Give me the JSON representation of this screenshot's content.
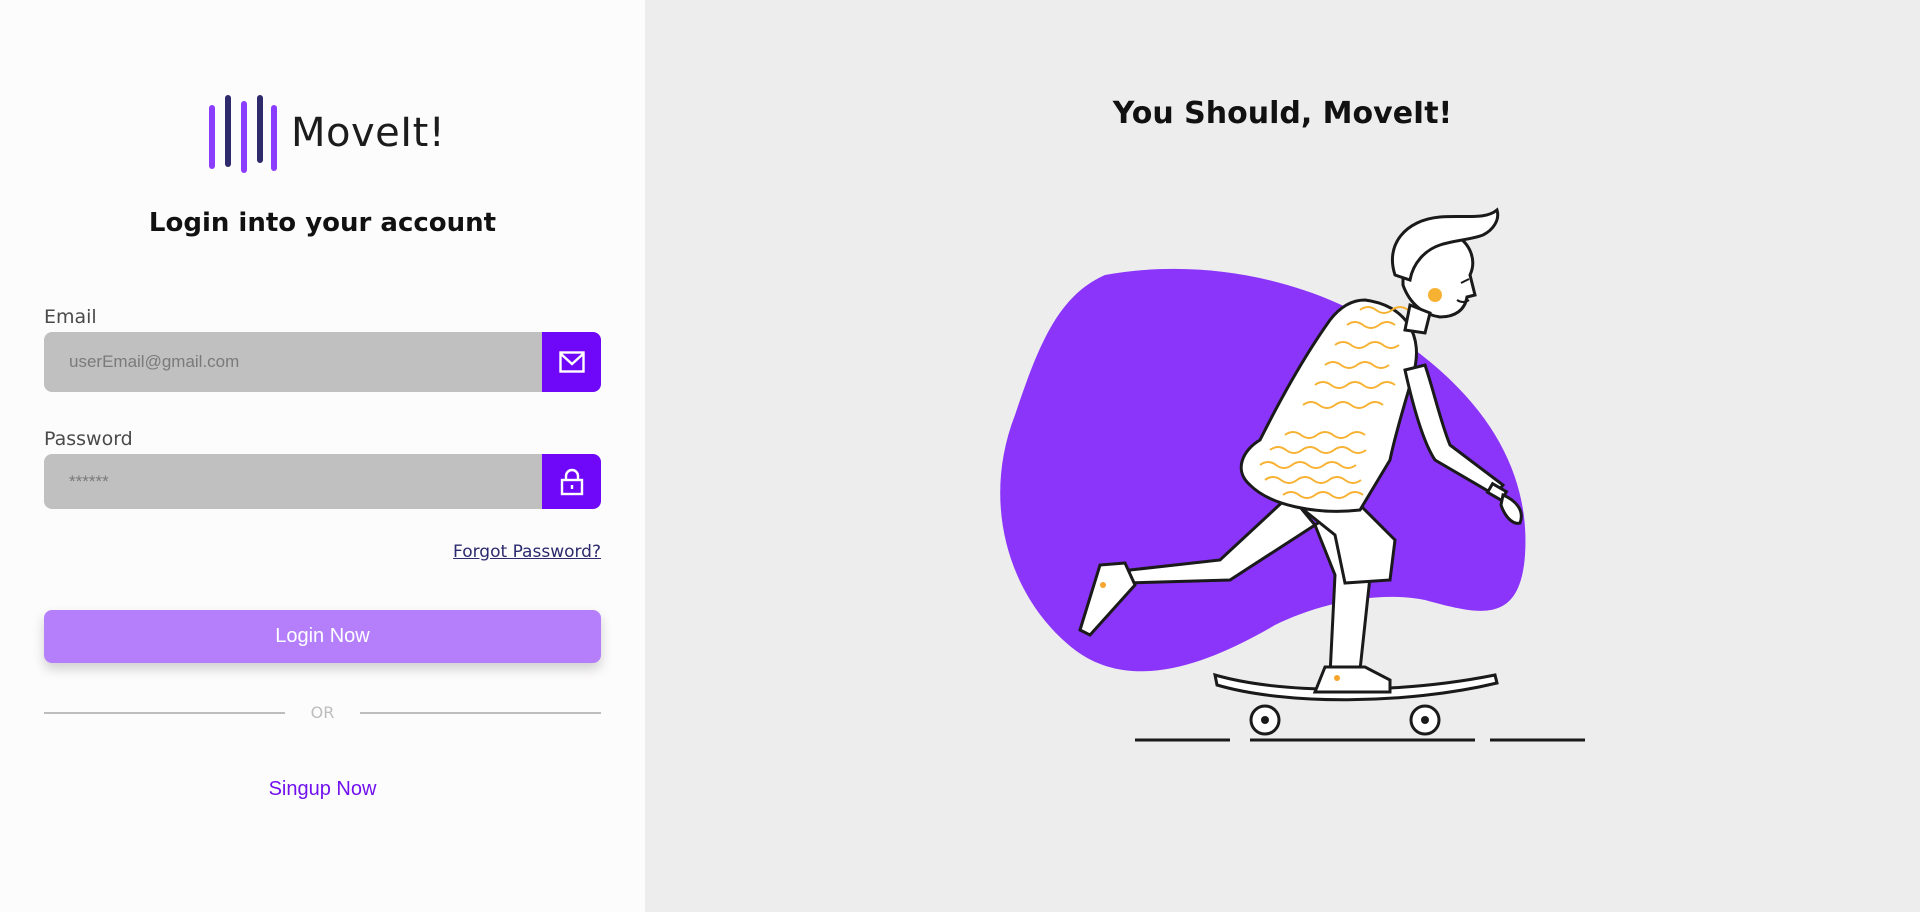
{
  "brand": {
    "name": "MoveIt!",
    "colors": {
      "primary": "#6f08f8",
      "button": "#b57ffb",
      "link": "#7211f0",
      "blob": "#8a35f9"
    }
  },
  "login": {
    "heading": "Login into your account",
    "email": {
      "label": "Email",
      "placeholder": "userEmail@gmail.com",
      "icon": "mail-icon"
    },
    "password": {
      "label": "Password",
      "placeholder": "******",
      "icon": "lock-icon"
    },
    "forgot_label": "Forgot Password?",
    "login_label": "Login Now",
    "divider_label": "OR",
    "signup_label": "Singup Now"
  },
  "promo": {
    "title": "You Should, MoveIt!",
    "illustration": "skateboarder-illustration"
  }
}
